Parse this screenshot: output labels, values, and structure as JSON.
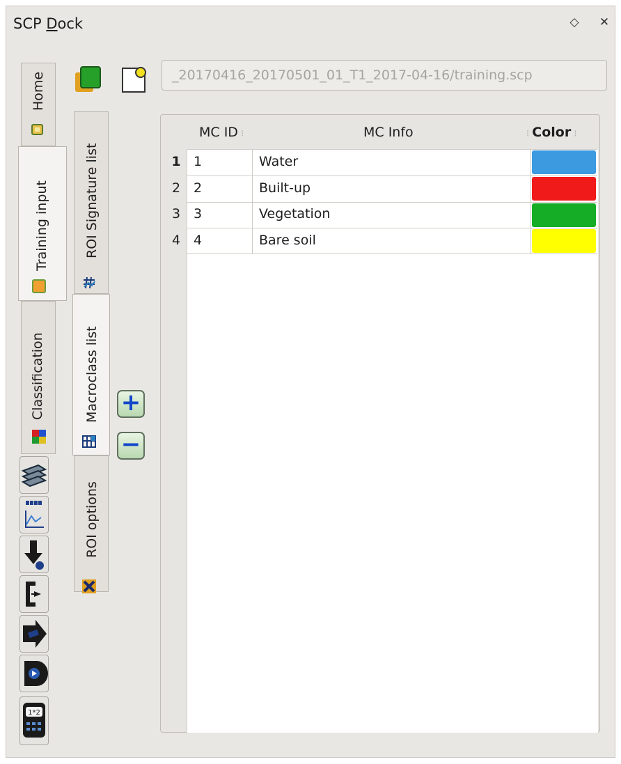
{
  "window": {
    "title_prefix": "SCP ",
    "title_mnemonic": "D",
    "title_rest": "ock",
    "float_icon": "◇",
    "close_icon": "✕"
  },
  "main_tabs": [
    {
      "label": "Home",
      "icon": "home-icon"
    },
    {
      "label": "Training input",
      "icon": "training-input-icon"
    },
    {
      "label": "Classification",
      "icon": "classification-icon"
    }
  ],
  "tool_icons": [
    "layers-stack-icon",
    "spectral-plot-icon",
    "download-icon",
    "preprocessing-icon",
    "postprocessing-icon",
    "band-calc-icon",
    "band-set-icon"
  ],
  "sub_tabs": [
    {
      "label": "ROI Signature list",
      "icon": "roi-signature-icon"
    },
    {
      "label": "Macroclass list",
      "icon": "macroclass-table-icon"
    },
    {
      "label": "ROI options",
      "icon": "roi-options-icon"
    }
  ],
  "toolbar": {
    "new_file_icon": "new-training-file-icon",
    "open_file_icon": "open-training-file-icon",
    "file_path": "_20170416_20170501_01_T1_2017-04-16/training.scp"
  },
  "table": {
    "headers": {
      "id": "MC ID",
      "info": "MC Info",
      "color": "Color"
    },
    "rows": [
      {
        "num": "1",
        "id": "1",
        "info": "Water",
        "color": "#3b9ae0"
      },
      {
        "num": "2",
        "id": "2",
        "info": "Built-up",
        "color": "#f01a1a"
      },
      {
        "num": "3",
        "id": "3",
        "info": "Vegetation",
        "color": "#16ad26"
      },
      {
        "num": "4",
        "id": "4",
        "info": "Bare soil",
        "color": "#ffff00"
      }
    ]
  },
  "buttons": {
    "add": "+",
    "remove": "−"
  }
}
